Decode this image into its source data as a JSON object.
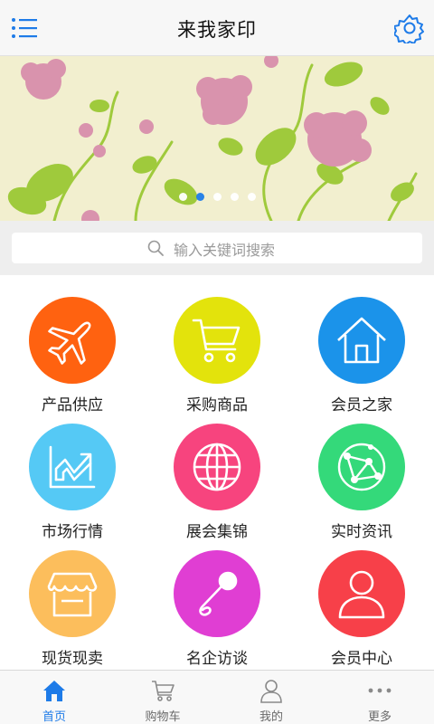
{
  "header": {
    "title": "来我家印",
    "menu_icon": "hamburger-menu-icon",
    "settings_icon": "gear-icon",
    "accent": "#1e7be8"
  },
  "banner": {
    "slide_count": 5,
    "active_index": 1
  },
  "search": {
    "placeholder": "输入关键词搜索"
  },
  "grid": [
    {
      "label": "产品供应",
      "icon": "airplane-icon",
      "color": "#ff6210"
    },
    {
      "label": "采购商品",
      "icon": "cart-icon",
      "color": "#e3e30c"
    },
    {
      "label": "会员之家",
      "icon": "house-icon",
      "color": "#1b93ea"
    },
    {
      "label": "市场行情",
      "icon": "trend-chart-icon",
      "color": "#55c9f5"
    },
    {
      "label": "展会集锦",
      "icon": "globe-icon",
      "color": "#f7447e"
    },
    {
      "label": "实时资讯",
      "icon": "network-icon",
      "color": "#34d97a"
    },
    {
      "label": "现货现卖",
      "icon": "shop-icon",
      "color": "#fcbe5c"
    },
    {
      "label": "名企访谈",
      "icon": "microphone-icon",
      "color": "#e03ed3"
    },
    {
      "label": "会员中心",
      "icon": "user-icon",
      "color": "#f74049"
    }
  ],
  "tabs": [
    {
      "label": "首页",
      "icon": "home-icon",
      "active": true
    },
    {
      "label": "购物车",
      "icon": "cart-icon",
      "active": false
    },
    {
      "label": "我的",
      "icon": "user-icon",
      "active": false
    },
    {
      "label": "更多",
      "icon": "more-dots-icon",
      "active": false
    }
  ]
}
